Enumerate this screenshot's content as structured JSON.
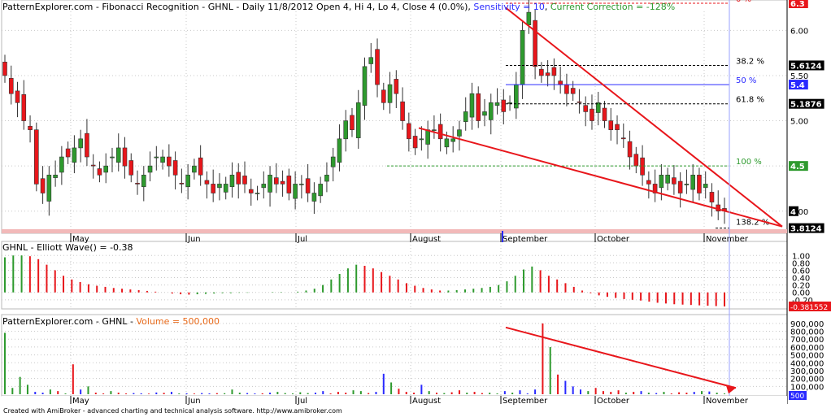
{
  "header": {
    "title": "PatternExplorer.com - Fibonacci Recognition - GHNL - Daily 11/8/2012 Open 4, Hi 4, Lo 4, Close 4 (0.0%)",
    "sensitivity": "Sensitivity = 10",
    "correction": "Current Correction = -128%",
    "separator": ","
  },
  "footer": {
    "text": "Created with AmiBroker - advanced charting and technical analysis software. http://www.amibroker.com"
  },
  "colors": {
    "up": "#2e9a2e",
    "down": "#e8161b",
    "blue": "#2a2aff",
    "neutral_axis": "#d8d8d8"
  },
  "chart_data": [
    {
      "type": "candlestick",
      "symbol": "GHNL",
      "x_labels": [
        "May",
        "Jun",
        "Jul",
        "August",
        "September",
        "October",
        "November"
      ],
      "y_ticks": [
        4.0,
        4.5,
        5.0,
        5.5,
        6.0
      ],
      "ylim": [
        3.8,
        6.3
      ],
      "fib_levels": [
        {
          "pct": "0 %",
          "price": 6.3,
          "price_label": "6.3",
          "color": "#e8161b"
        },
        {
          "pct": "38.2 %",
          "price": 5.6124,
          "price_label": "5.6124",
          "color": "#000000"
        },
        {
          "pct": "50 %",
          "price": 5.4,
          "price_label": "5.4",
          "color": "#2a2aff"
        },
        {
          "pct": "61.8 %",
          "price": 5.1876,
          "price_label": "5.1876",
          "color": "#000000"
        },
        {
          "pct": "100 %",
          "price": 4.5,
          "price_label": "4.5",
          "color": "#2e9a2e"
        },
        {
          "pct": "138.2 %",
          "price": 3.8124,
          "price_label": "3.8124",
          "color": "#000000"
        }
      ],
      "last_close_label": "4",
      "trendlines": "descending wedge (red), drawn from September high and August low toward November",
      "close_series": [
        5.5,
        5.3,
        5.2,
        5.0,
        4.9,
        4.3,
        4.2,
        4.4,
        4.4,
        4.6,
        4.6,
        4.7,
        4.8,
        4.6,
        4.5,
        4.4,
        4.5,
        4.6,
        4.7,
        4.5,
        4.4,
        4.3,
        4.4,
        4.5,
        4.6,
        4.6,
        4.5,
        4.4,
        4.3,
        4.4,
        4.5,
        4.4,
        4.3,
        4.2,
        4.3,
        4.3,
        4.4,
        4.3,
        4.3,
        4.2,
        4.2,
        4.3,
        4.4,
        4.3,
        4.3,
        4.2,
        4.3,
        4.3,
        4.2,
        4.2,
        4.3,
        4.4,
        4.6,
        4.8,
        5.0,
        4.9,
        5.2,
        5.6,
        5.7,
        5.4,
        5.2,
        5.4,
        5.3,
        5.0,
        4.8,
        4.7,
        4.8,
        4.9,
        4.9,
        4.8,
        4.8,
        4.8,
        4.9,
        5.1,
        5.3,
        5.0,
        5.1,
        5.2,
        5.2,
        5.1,
        5.2,
        5.4,
        6.0,
        6.2,
        5.6,
        5.5,
        5.5,
        5.5,
        5.4,
        5.3,
        5.3,
        5.2,
        5.1,
        5.0,
        5.2,
        5.0,
        4.9,
        4.9,
        4.8,
        4.6,
        4.5,
        4.4,
        4.3,
        4.2,
        4.4,
        4.4,
        4.3,
        4.2,
        4.3,
        4.4,
        4.2,
        4.3,
        4.1,
        4.0,
        4.0
      ]
    },
    {
      "type": "bar",
      "title": "GHNL - Elliott Wave() = -0.38",
      "y_ticks": [
        "1.00",
        "0.80",
        "0.60",
        "0.40",
        "0.20",
        "0.00",
        "-0.20"
      ],
      "ylim": [
        -0.38,
        1.05
      ],
      "last_value_label": "-0.381552",
      "values": [
        0.95,
        1.0,
        1.0,
        0.98,
        0.9,
        0.75,
        0.6,
        0.45,
        0.35,
        0.28,
        0.22,
        0.18,
        0.15,
        0.12,
        0.1,
        0.08,
        0.06,
        0.04,
        0.02,
        0.0,
        -0.03,
        -0.05,
        -0.06,
        -0.05,
        -0.04,
        -0.03,
        -0.02,
        -0.02,
        -0.01,
        -0.01,
        0.0,
        0.0,
        0.01,
        0.01,
        0.0,
        0.02,
        0.05,
        0.1,
        0.2,
        0.35,
        0.5,
        0.65,
        0.75,
        0.72,
        0.65,
        0.55,
        0.45,
        0.35,
        0.25,
        0.18,
        0.12,
        0.08,
        0.05,
        0.05,
        0.06,
        0.08,
        0.1,
        0.12,
        0.15,
        0.2,
        0.3,
        0.45,
        0.62,
        0.7,
        0.6,
        0.45,
        0.35,
        0.25,
        0.15,
        0.05,
        -0.02,
        -0.08,
        -0.12,
        -0.15,
        -0.18,
        -0.2,
        -0.22,
        -0.25,
        -0.28,
        -0.3,
        -0.32,
        -0.33,
        -0.34,
        -0.35,
        -0.36,
        -0.37,
        -0.38
      ]
    },
    {
      "type": "bar",
      "title": "Volume = 500,000",
      "title_prefix": "PatternExplorer.com - GHNL - ",
      "y_ticks": [
        "900,000",
        "800,000",
        "700,000",
        "600,000",
        "500,000",
        "400,000",
        "300,000",
        "200,000",
        "100,000"
      ],
      "ylim": [
        0,
        950000
      ],
      "last_value_label": "500",
      "values": [
        780000,
        80000,
        220000,
        120000,
        30000,
        20000,
        60000,
        40000,
        10000,
        380000,
        60000,
        100000,
        20000,
        10000,
        40000,
        20000,
        10000,
        15000,
        12000,
        8000,
        22000,
        18000,
        30000,
        10000,
        12000,
        9000,
        15000,
        11000,
        14000,
        13000,
        60000,
        20000,
        15000,
        10000,
        12000,
        20000,
        30000,
        15000,
        10000,
        25000,
        15000,
        20000,
        40000,
        10000,
        30000,
        20000,
        50000,
        40000,
        15000,
        30000,
        260000,
        150000,
        70000,
        30000,
        20000,
        120000,
        40000,
        20000,
        15000,
        25000,
        50000,
        20000,
        30000,
        15000,
        20000,
        10000,
        40000,
        20000,
        50000,
        10000,
        60000,
        900000,
        600000,
        250000,
        170000,
        100000,
        60000,
        40000,
        80000,
        40000,
        30000,
        50000,
        20000,
        30000,
        40000,
        20000,
        15000,
        30000,
        10000,
        25000,
        20000,
        30000,
        40000,
        35000,
        20000,
        10000
      ]
    }
  ]
}
